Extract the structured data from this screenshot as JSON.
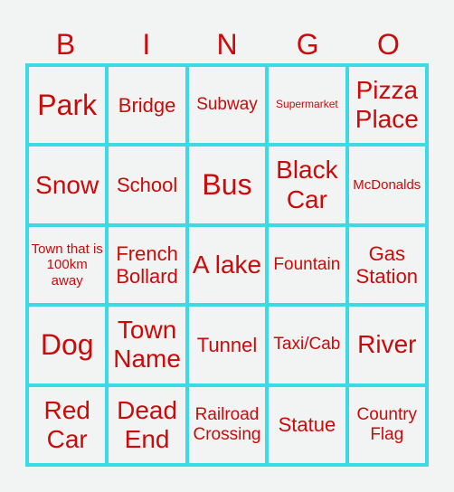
{
  "header": [
    "B",
    "I",
    "N",
    "G",
    "O"
  ],
  "cells": [
    {
      "text": "Park",
      "size": "xl"
    },
    {
      "text": "Bridge",
      "size": "m"
    },
    {
      "text": "Subway",
      "size": "s"
    },
    {
      "text": "Supermarket",
      "size": "xxs"
    },
    {
      "text": "Pizza Place",
      "size": "l"
    },
    {
      "text": "Snow",
      "size": "l"
    },
    {
      "text": "School",
      "size": "m"
    },
    {
      "text": "Bus",
      "size": "xl"
    },
    {
      "text": "Black Car",
      "size": "l"
    },
    {
      "text": "McDonalds",
      "size": "xs"
    },
    {
      "text": "Town that is 100km away",
      "size": "xs"
    },
    {
      "text": "French Bollard",
      "size": "m"
    },
    {
      "text": "A lake",
      "size": "l"
    },
    {
      "text": "Fountain",
      "size": "s"
    },
    {
      "text": "Gas Station",
      "size": "m"
    },
    {
      "text": "Dog",
      "size": "xl"
    },
    {
      "text": "Town Name",
      "size": "l"
    },
    {
      "text": "Tunnel",
      "size": "m"
    },
    {
      "text": "Taxi/Cab",
      "size": "s"
    },
    {
      "text": "River",
      "size": "l"
    },
    {
      "text": "Red Car",
      "size": "l"
    },
    {
      "text": "Dead End",
      "size": "l"
    },
    {
      "text": "Railroad Crossing",
      "size": "s"
    },
    {
      "text": "Statue",
      "size": "m"
    },
    {
      "text": "Country Flag",
      "size": "s"
    }
  ],
  "colors": {
    "text": "#cc0a0a",
    "grid": "#3cdae4",
    "background": "#f2f3f3"
  }
}
